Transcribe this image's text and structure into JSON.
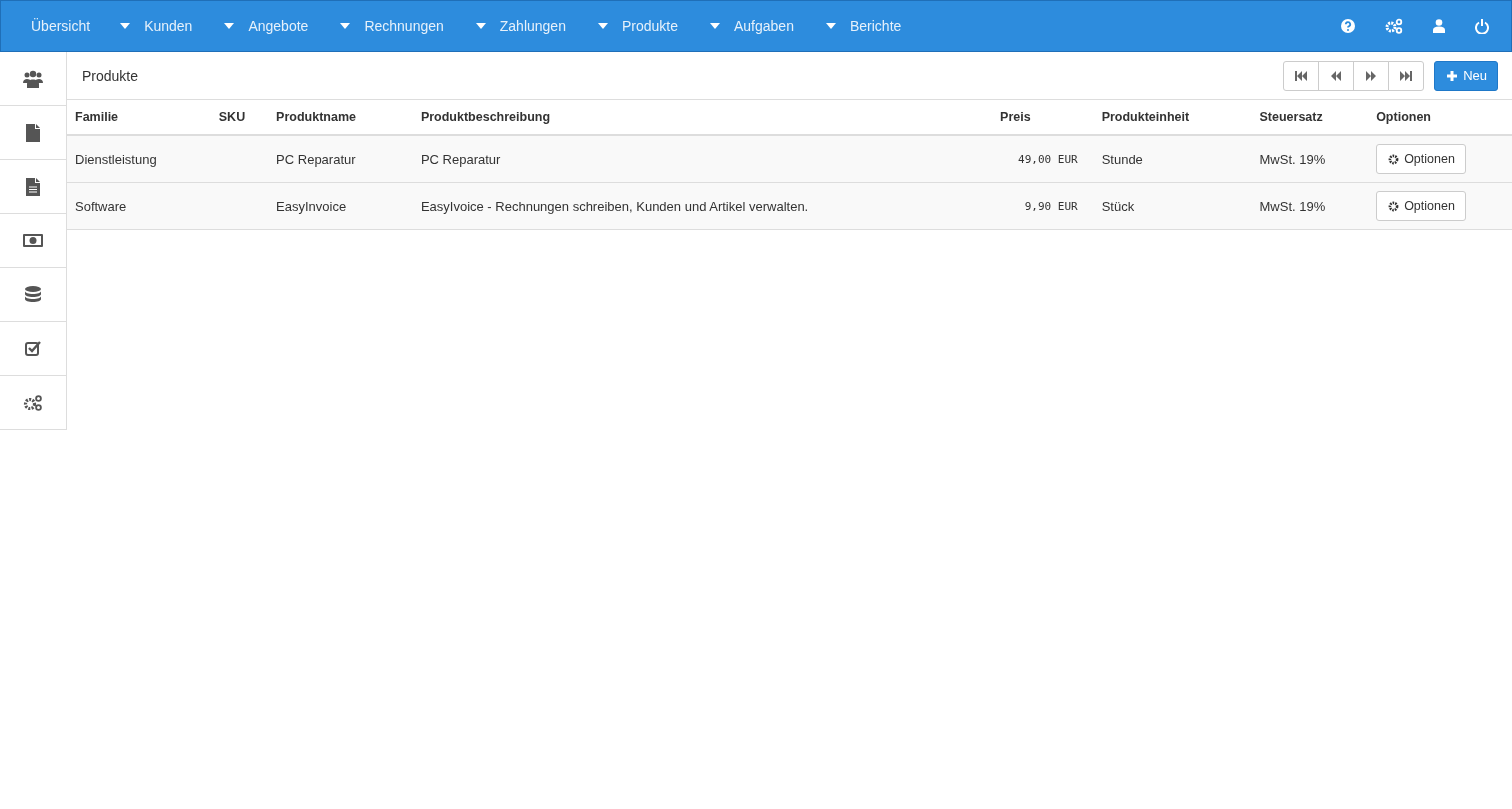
{
  "nav": [
    {
      "label": "Übersicht",
      "dropdown": false
    },
    {
      "label": "Kunden",
      "dropdown": true
    },
    {
      "label": "Angebote",
      "dropdown": true
    },
    {
      "label": "Rechnungen",
      "dropdown": true
    },
    {
      "label": "Zahlungen",
      "dropdown": true
    },
    {
      "label": "Produkte",
      "dropdown": true
    },
    {
      "label": "Aufgaben",
      "dropdown": true
    },
    {
      "label": "Berichte",
      "dropdown": true
    }
  ],
  "page_title": "Produkte",
  "new_button": "Neu",
  "table": {
    "columns": [
      "Familie",
      "SKU",
      "Produktname",
      "Produktbeschreibung",
      "Preis",
      "Produkteinheit",
      "Steuersatz",
      "Optionen"
    ],
    "rows": [
      {
        "familie": "Dienstleistung",
        "name": "PC Reparatur",
        "beschreibung": "PC Reparatur",
        "preis": "49,00 EUR",
        "einheit": "Stunde",
        "steuer": "MwSt. 19%",
        "option": "Optionen"
      },
      {
        "familie": "Software",
        "name": "EasyInvoice",
        "beschreibung": "EasyIvoice - Rechnungen schreiben, Kunden und Artikel verwalten.",
        "preis": "9,90 EUR",
        "einheit": "Stück",
        "steuer": "MwSt. 19%",
        "option": "Optionen"
      }
    ]
  }
}
